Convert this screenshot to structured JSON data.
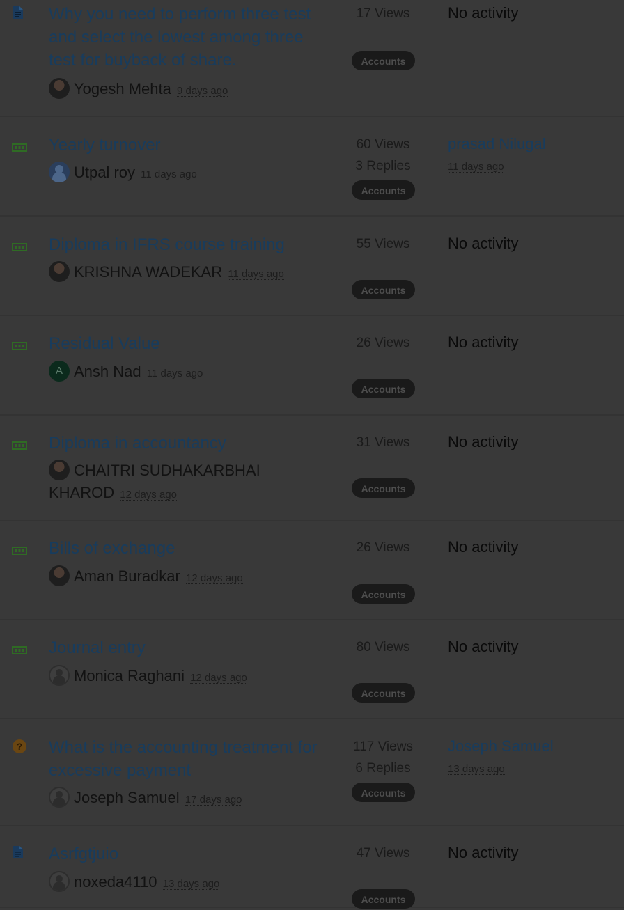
{
  "topics": [
    {
      "icon": "document-icon",
      "title": "Why you need to perform three test and select the lowest among three test for buyback of share.",
      "author": "Yogesh Mehta",
      "avatar": "photo",
      "time": "9 days ago",
      "views": "17 Views",
      "replies": "",
      "category": "Accounts",
      "last_activity": {
        "type": "none",
        "text": "No activity"
      }
    },
    {
      "icon": "discussion-icon",
      "title": "Yearly turnover",
      "author": "Utpal roy",
      "avatar": "blue",
      "time": "11 days ago",
      "views": "60 Views",
      "replies": "3 Replies",
      "category": "Accounts",
      "last_activity": {
        "type": "user",
        "name": "prasad Nilugal",
        "time": "11 days ago"
      }
    },
    {
      "icon": "discussion-icon",
      "title": "Diploma in IFRS course training",
      "author": "KRISHNA WADEKAR",
      "avatar": "photo",
      "time": "11 days ago",
      "views": "55 Views",
      "replies": "",
      "category": "Accounts",
      "last_activity": {
        "type": "none",
        "text": "No activity"
      }
    },
    {
      "icon": "discussion-icon",
      "title": "Residual Value",
      "author": "Ansh Nad",
      "avatar": "letter",
      "avatar_letter": "A",
      "time": "11 days ago",
      "views": "26 Views",
      "replies": "",
      "category": "Accounts",
      "last_activity": {
        "type": "none",
        "text": "No activity"
      }
    },
    {
      "icon": "discussion-icon",
      "title": "Diploma in accountancy",
      "author": "CHAITRI SUDHAKARBHAI KHAROD",
      "avatar": "photo",
      "time": "12 days ago",
      "views": "31 Views",
      "replies": "",
      "category": "Accounts",
      "last_activity": {
        "type": "none",
        "text": "No activity"
      }
    },
    {
      "icon": "discussion-icon",
      "title": "Bills of exchange",
      "author": "Aman Buradkar",
      "avatar": "photo",
      "time": "12 days ago",
      "views": "26 Views",
      "replies": "",
      "category": "Accounts",
      "last_activity": {
        "type": "none",
        "text": "No activity"
      }
    },
    {
      "icon": "discussion-icon",
      "title": "Journal entry",
      "author": "Monica Raghani",
      "avatar": "default",
      "time": "12 days ago",
      "views": "80 Views",
      "replies": "",
      "category": "Accounts",
      "last_activity": {
        "type": "none",
        "text": "No activity"
      }
    },
    {
      "icon": "question-icon",
      "title": "What is the accounting treatment for excessive payment",
      "author": "Joseph Samuel",
      "avatar": "default",
      "time": "17 days ago",
      "views": "117 Views",
      "replies": "6 Replies",
      "category": "Accounts",
      "last_activity": {
        "type": "user",
        "name": "Joseph Samuel",
        "time": "13 days ago"
      }
    },
    {
      "icon": "document-icon",
      "title": "Asrfgtjuio",
      "author": "noxeda4110",
      "avatar": "default",
      "time": "13 days ago",
      "views": "47 Views",
      "replies": "",
      "category": "Accounts",
      "last_activity": {
        "type": "none",
        "text": "No activity"
      }
    }
  ],
  "colors": {
    "background": "#393939",
    "link": "#183c5d",
    "document_icon": "#1a3a5c",
    "discussion_icon": "#2f6b24",
    "question_icon": "#6a4612",
    "badge": "#1a1a1a"
  }
}
